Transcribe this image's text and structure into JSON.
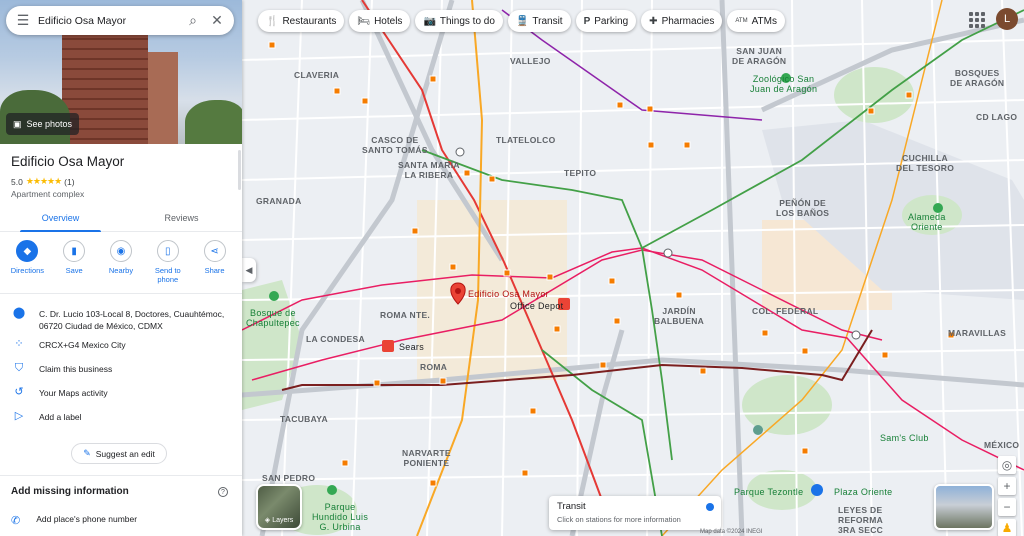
{
  "search": {
    "query": "Edificio Osa Mayor"
  },
  "hero": {
    "see_photos": "See photos"
  },
  "place": {
    "title": "Edificio Osa Mayor",
    "rating": "5.0",
    "stars": "★★★★★",
    "reviews_count": "(1)",
    "category": "Apartment complex"
  },
  "tabs": [
    {
      "label": "Overview"
    },
    {
      "label": "Reviews"
    }
  ],
  "actions": [
    {
      "label": "Directions",
      "icon": "directions-icon"
    },
    {
      "label": "Save",
      "icon": "bookmark-icon"
    },
    {
      "label": "Nearby",
      "icon": "nearby-icon"
    },
    {
      "label": "Send to phone",
      "icon": "phone-icon"
    },
    {
      "label": "Share",
      "icon": "share-icon"
    }
  ],
  "info": {
    "address": "C. Dr. Lucio 103-Local 8, Doctores, Cuauhtémoc, 06720 Ciudad de México, CDMX",
    "plus_code": "CRCX+G4 Mexico City",
    "claim": "Claim this business",
    "maps_activity": "Your Maps activity",
    "add_label": "Add a label"
  },
  "suggest_edit": "Suggest an edit",
  "missing": {
    "title": "Add missing information",
    "phone": "Add place's phone number"
  },
  "chips": [
    {
      "label": "Restaurants",
      "icon": "🍴"
    },
    {
      "label": "Hotels",
      "icon": "🛏"
    },
    {
      "label": "Things to do",
      "icon": "📷"
    },
    {
      "label": "Transit",
      "icon": "🚆"
    },
    {
      "label": "Parking",
      "icon": "P"
    },
    {
      "label": "Pharmacies",
      "icon": "✚"
    },
    {
      "label": "ATMs",
      "icon": "ATM"
    }
  ],
  "avatar": "L",
  "layers_label": "Layers",
  "transit_card": {
    "title": "Transit",
    "subtitle": "Click on stations for more information"
  },
  "footer": "Map data ©2024 INEGI",
  "map_labels": {
    "vallejo": "VALLEJO",
    "claveria": "CLAVERIA",
    "san_juan_aragon": "SAN JUAN\nDE ARAGÓN",
    "bosques_aragon": "BOSQUES\nDE ARAGÓN",
    "zoo": "Zoológico San\nJuan de Aragón",
    "cd_lago": "CD LAGO",
    "casco": "CASCO DE\nSANTO TOMÁS",
    "tlatelolco": "TLATELOLCO",
    "santa_maria": "SANTA MARÍA\nLA RIBERA",
    "tepito": "TEPITO",
    "cuchilla": "CUCHILLA\nDEL TESORO",
    "granada": "GRANADA",
    "penon": "PEÑÓN DE\nLOS BAÑOS",
    "alameda": "Alameda\nOriente",
    "roma_nte": "ROMA NTE.",
    "jardin": "JARDÍN\nBALBUENA",
    "col_federal": "COL. FEDERAL",
    "bosque_chap": "Bosque de\nChapultepec",
    "la_condesa": "LA CONDESA",
    "maravillas": "MARAVILLAS",
    "roma": "ROMA",
    "tacubaya": "TACUBAYA",
    "narvarte": "NARVARTE\nPONIENTE",
    "sams": "Sam's Club",
    "san_pedro": "SAN PEDRO",
    "parque_hundido": "Parque\nHundido Luis\nG. Urbina",
    "parque_tezontle": "Parque Tezontle",
    "plaza_oriente": "Plaza Oriente",
    "reforma": "LEYES DE\nREFORMA\n3RA SECC",
    "mexico": "MÉXICO",
    "pin_label": "Edificio Osa Mayor",
    "office_depot": "Office Depot",
    "sears": "Sears"
  }
}
